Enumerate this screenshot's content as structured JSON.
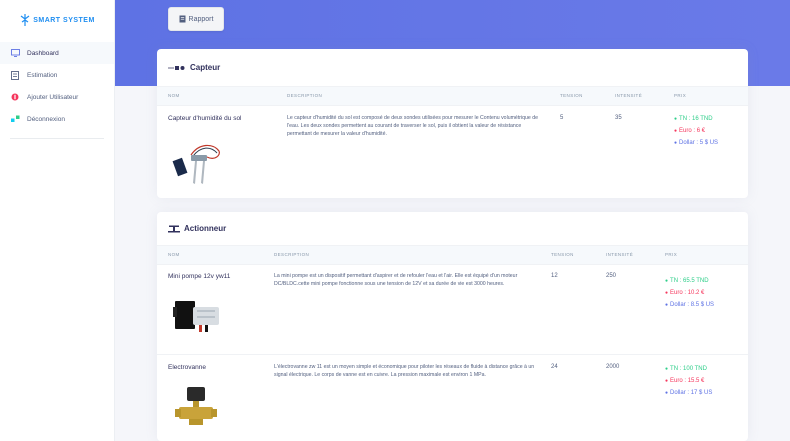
{
  "app": {
    "logo_text": "SMART SYSTEM"
  },
  "sidebar": {
    "items": [
      {
        "label": "Dashboard",
        "icon": "monitor-icon"
      },
      {
        "label": "Estimation",
        "icon": "calculator-icon"
      },
      {
        "label": "Ajouter Utilisateur",
        "icon": "user-add-icon"
      },
      {
        "label": "Déconnexion",
        "icon": "logout-icon"
      }
    ]
  },
  "header": {
    "rapport_label": "Rapport"
  },
  "capteur": {
    "title": "Capteur",
    "columns": [
      "NOM",
      "DESCRIPTION",
      "TENSION",
      "INTENSITÉ",
      "PRIX"
    ],
    "rows": [
      {
        "nom": "Capteur d'humidité du sol",
        "description": "Le capteur d'humidité du sol est composé de deux sondes utilisées pour mesurer le Contenu volumétrique de l'eau. Les deux sondes permettent au courant de traverser le sol, puis il obtient la valeur de résistance permettant de mesurer la valeur d'humidité.",
        "tension": "5",
        "intensite": "35",
        "prix": {
          "tn": "TN : 16 TND",
          "euro": "Euro : 6 €",
          "dollar": "Dollar : 5 $ US"
        }
      }
    ]
  },
  "actionneur": {
    "title": "Actionneur",
    "columns": [
      "NOM",
      "DESCRIPTION",
      "TENSION",
      "INTENSITÉ",
      "PRIX"
    ],
    "rows": [
      {
        "nom": "Mini pompe 12v yw11",
        "description": "La mini pompe est un dispositif permettant d'aspirer et de refouler l'eau et l'air. Elle est équipé d'un moteur DC/BLDC.cette mini pompe fonctionne sous une tension de 12V et sa durée de vie est 3000 heures.",
        "tension": "12",
        "intensite": "250",
        "prix": {
          "tn": "TN : 65.5 TND",
          "euro": "Euro : 10.2 €",
          "dollar": "Dollar : 8.5 $ US"
        }
      },
      {
        "nom": "Electrovanne",
        "description": "L'électrovanne zw 11 est un moyen simple et économique pour piloter les réseaux de fluide à distance grâce à un signal électrique. Le corps de vanne est en cuivre. La pression maximale est environ 1 MPa.",
        "tension": "24",
        "intensite": "2000",
        "prix": {
          "tn": "TN : 100 TND",
          "euro": "Euro : 15.5 €",
          "dollar": "Dollar : 17 $ US"
        }
      }
    ]
  },
  "colors": {
    "primary": "#5e72e4",
    "success": "#2dce89",
    "danger": "#f5365c",
    "info": "#11cdef"
  }
}
